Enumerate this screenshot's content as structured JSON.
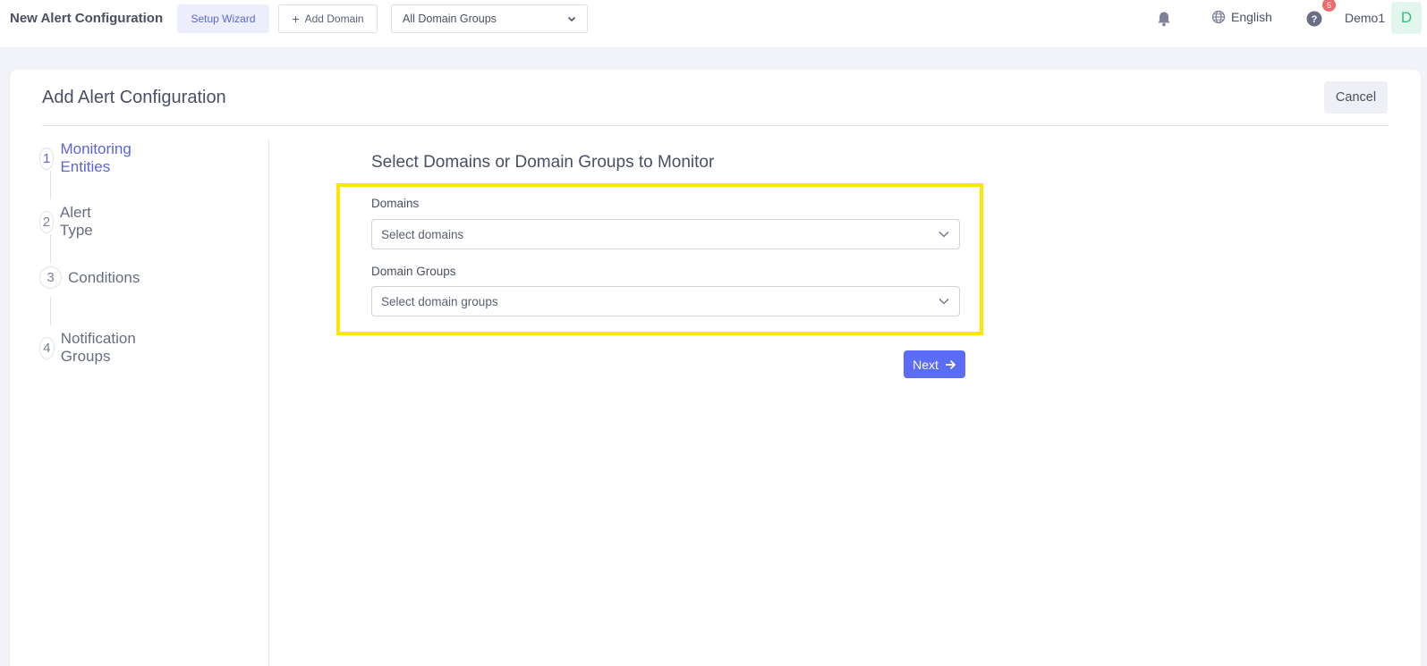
{
  "header": {
    "title": "New Alert Configuration",
    "setup_wizard_label": "Setup Wizard",
    "add_domain_label": "Add Domain",
    "domain_group_select": "All Domain Groups",
    "language": "English",
    "help_badge_count": "5",
    "user_name": "Demo1",
    "avatar_initial": "D"
  },
  "card": {
    "title": "Add Alert Configuration",
    "cancel_label": "Cancel"
  },
  "steps": [
    {
      "number": "1",
      "label": "Monitoring Entities",
      "active": true
    },
    {
      "number": "2",
      "label": "Alert Type",
      "active": false
    },
    {
      "number": "3",
      "label": "Conditions",
      "active": false
    },
    {
      "number": "4",
      "label": "Notification Groups",
      "active": false
    }
  ],
  "form": {
    "title": "Select Domains or Domain Groups to Monitor",
    "domains_label": "Domains",
    "domains_placeholder": "Select domains",
    "domain_groups_label": "Domain Groups",
    "domain_groups_placeholder": "Select domain groups",
    "next_label": "Next"
  },
  "colors": {
    "accent": "#5b65d8",
    "primary_button": "#5b6cf5",
    "highlight": "#ffe600",
    "badge": "#ee6b6b"
  },
  "icons": [
    "plus-icon",
    "chevron-down-icon",
    "bell-icon",
    "globe-icon",
    "help-icon",
    "arrow-right-icon"
  ]
}
